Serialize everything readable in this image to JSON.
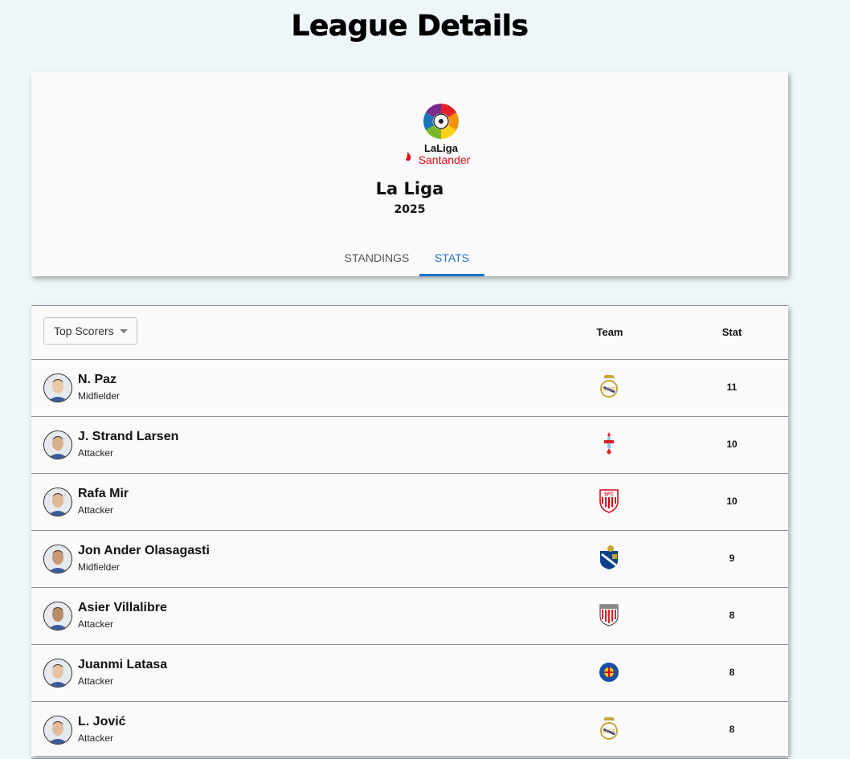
{
  "page": {
    "title": "League Details"
  },
  "league": {
    "logo_text_1": "LaLiga",
    "logo_text_2": "Santander",
    "name": "La Liga",
    "season": "2025"
  },
  "tabs": [
    {
      "label": "STANDINGS",
      "active": false
    },
    {
      "label": "STATS",
      "active": true
    }
  ],
  "stats": {
    "category_select": "Top Scorers",
    "columns": {
      "team": "Team",
      "stat": "Stat"
    },
    "rows": [
      {
        "name": "N. Paz",
        "position": "Midfielder",
        "team_crest": "real-madrid-crest-icon",
        "stat": "11"
      },
      {
        "name": "J. Strand Larsen",
        "position": "Attacker",
        "team_crest": "celta-vigo-crest-icon",
        "stat": "10"
      },
      {
        "name": "Rafa Mir",
        "position": "Attacker",
        "team_crest": "sevilla-crest-icon",
        "stat": "10"
      },
      {
        "name": "Jon Ander Olasagasti",
        "position": "Midfielder",
        "team_crest": "real-sociedad-crest-icon",
        "stat": "9"
      },
      {
        "name": "Asier Villalibre",
        "position": "Attacker",
        "team_crest": "athletic-bilbao-crest-icon",
        "stat": "8"
      },
      {
        "name": "Juanmi Latasa",
        "position": "Attacker",
        "team_crest": "getafe-crest-icon",
        "stat": "8"
      },
      {
        "name": "L. Jović",
        "position": "Attacker",
        "team_crest": "real-madrid-crest-icon",
        "stat": "8"
      }
    ]
  },
  "colors": {
    "accent": "#1e73c8",
    "background": "#eef6f9",
    "card": "#fafafa"
  }
}
